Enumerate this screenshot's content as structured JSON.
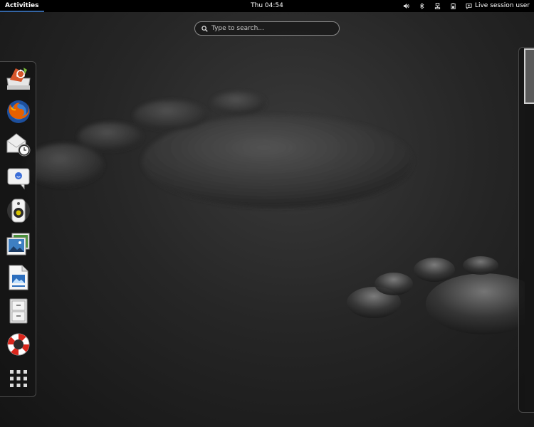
{
  "topbar": {
    "activities_label": "Activities",
    "clock": "Thu 04:54",
    "tray_icons": [
      "volume-icon",
      "bluetooth-icon",
      "network-icon",
      "battery-icon"
    ],
    "user_label": "Live session user"
  },
  "search": {
    "placeholder": "Type to search..."
  },
  "dash": {
    "apps": [
      {
        "name": "software-center",
        "icon": "package-icon"
      },
      {
        "name": "firefox",
        "icon": "firefox-icon"
      },
      {
        "name": "mail-client",
        "icon": "mail-clock-icon"
      },
      {
        "name": "messaging",
        "icon": "chat-icon"
      },
      {
        "name": "music-player",
        "icon": "speaker-icon"
      },
      {
        "name": "image-viewer",
        "icon": "photos-icon"
      },
      {
        "name": "document-editor",
        "icon": "document-icon"
      },
      {
        "name": "file-manager",
        "icon": "cabinet-icon"
      },
      {
        "name": "help",
        "icon": "lifebuoy-icon"
      },
      {
        "name": "show-applications",
        "icon": "grid-icon"
      }
    ]
  },
  "colors": {
    "topbar_bg": "#000000",
    "accent": "#3465a4",
    "firefox_orange": "#e66000"
  }
}
